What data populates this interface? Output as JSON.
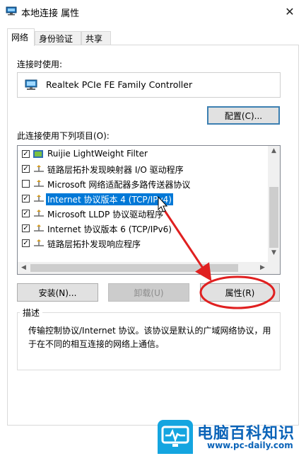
{
  "window": {
    "title": "本地连接 属性",
    "close_glyph": "✕"
  },
  "tabs": [
    {
      "label": "网络",
      "active": true
    },
    {
      "label": "身份验证",
      "active": false
    },
    {
      "label": "共享",
      "active": false
    }
  ],
  "connect_using_label": "连接时使用:",
  "adapter_name": "Realtek PCIe FE Family Controller",
  "configure_button": "配置(C)...",
  "items_label": "此连接使用下列项目(O):",
  "items": [
    {
      "label": "Ruijie LightWeight Filter",
      "checked": true,
      "icon": "filter-icon"
    },
    {
      "label": "链路层拓扑发现映射器 I/O 驱动程序",
      "checked": true,
      "icon": "protocol-icon"
    },
    {
      "label": "Microsoft 网络适配器多路传送器协议",
      "checked": false,
      "icon": "protocol-icon"
    },
    {
      "label": "Internet 协议版本 4 (TCP/IPv4)",
      "checked": true,
      "icon": "protocol-icon",
      "selected": true
    },
    {
      "label": "Microsoft LLDP 协议驱动程序",
      "checked": true,
      "icon": "protocol-icon"
    },
    {
      "label": "Internet 协议版本 6 (TCP/IPv6)",
      "checked": true,
      "icon": "protocol-icon"
    },
    {
      "label": "链路层拓扑发现响应程序",
      "checked": true,
      "icon": "protocol-icon"
    }
  ],
  "buttons": {
    "install": "安装(N)...",
    "uninstall": "卸载(U)",
    "properties": "属性(R)"
  },
  "description": {
    "title": "描述",
    "text_line1": "传输控制协议/Internet 协议。该协议是默认的广域网络协议，用",
    "text_line2": "于在不同的相互连接的网络上通信。"
  },
  "watermark": {
    "name": "电脑百科知识",
    "url": "www.pc-daily.com"
  },
  "colors": {
    "selection": "#0078d7",
    "annotation": "#e02020",
    "brand": "#0a63b8",
    "logo_bg": "#14a5e0"
  }
}
